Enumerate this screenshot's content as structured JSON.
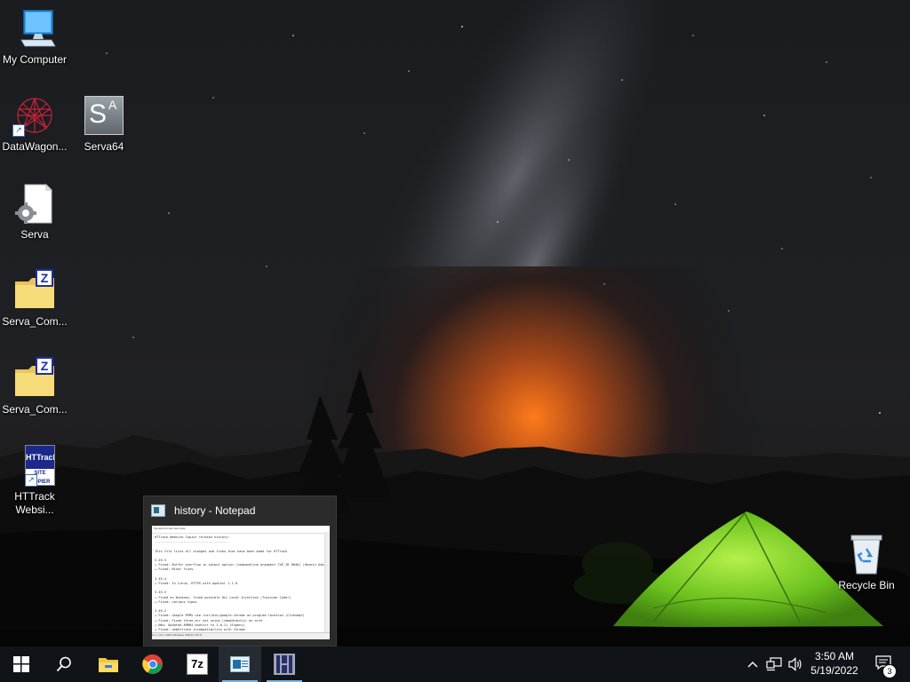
{
  "desktop_icons": [
    {
      "label": "My Computer",
      "icon": "computer-icon"
    },
    {
      "label": "DataWagon...",
      "icon": "datawagon-icon"
    },
    {
      "label": "Serva64",
      "icon": "serva64-icon"
    },
    {
      "label": "Serva",
      "icon": "config-file-icon"
    },
    {
      "label": "Serva_Com...",
      "icon": "zip-folder-icon"
    },
    {
      "label": "Serva_Com...",
      "icon": "zip-folder-icon"
    },
    {
      "label": "HTTrack Websi...",
      "icon": "httrack-icon"
    },
    {
      "label": "Recycle Bin",
      "icon": "recycle-bin-icon"
    }
  ],
  "icon_glyph_text": {
    "serva64": "S",
    "serva64_sup": "A",
    "zip": "Z",
    "httrack_top": "HTTrack",
    "httrack_bottom": "SITE COPIER",
    "sevenzip": "7z"
  },
  "preview": {
    "title": "history - Notepad",
    "menu": "File  Edit  Format  View  Help",
    "content": "HTTrack Website Copier release history:\n--------------------------------------\n\nThis file lists all changes and fixes that have been made for HTTrack\n\n3.49-5\n+ Fixed: Buffer overflow in output option (commandline argument CVE-ID 8040) (Hosein Askari)\n+ Fixed: Minor fixes\n\n3.49-4\n+ Fixed: In Linux, HTTPS with openssl 1.1.0\n\n3.49-3\n+ Fixed on Windows, fixed possible DLL Local Injection (Tunisian Cyber)\n+ Fixed: various typos\n\n3.49-2\n+ Fixed: Google RPMs use /usr/bin/google-chrome as program location (Cickumqt)\n+ Fixed: Fixed three-arr not using (immediately) on arch\n+ New: Updated ARM64 bootstr to 1.0.1j (Evgeni)\n+ Fixed: webhttrack incompatibility with Chrome\n+ Fixed: assertion failure at htslib.c:3458 (strlen(copyBuff) == qLen) seen on Linux\n+ Fixed: infamous crashes inside the DNS cache due to a corruption within the option struct",
    "status": "Ln 1, Col 1      100%    Windows (CRLF)    UTF-8"
  },
  "taskbar": {
    "buttons": [
      {
        "name": "start-button"
      },
      {
        "name": "search-button"
      },
      {
        "name": "file-explorer-button"
      },
      {
        "name": "chrome-button"
      },
      {
        "name": "7zip-button"
      },
      {
        "name": "notepad-button"
      },
      {
        "name": "serva-taskbar-button"
      }
    ],
    "time": "3:50 AM",
    "date": "5/19/2022",
    "notification_count": "3"
  },
  "colors": {
    "taskbar_bg": "#101418",
    "accent": "#76b9ed",
    "tent": "#7ed12a"
  }
}
